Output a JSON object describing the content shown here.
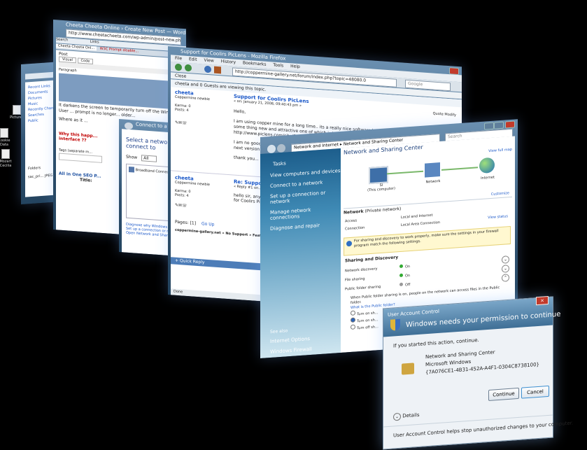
{
  "desktop": {
    "icons": [
      "Pictures",
      "Cookie Data",
      "Mozart Cecilia"
    ]
  },
  "explorer": {
    "tree": [
      "Recent Links",
      "Documents",
      "Pictures",
      "Music",
      "Recently Changed",
      "Searches",
      "Public"
    ],
    "folders_label": "Folders",
    "file": "sac_pri... JPEG Ima..."
  },
  "wp_window": {
    "title": "Cheeta Cheeta Online › Create New Post — WordPress — Windows Internet Explorer",
    "address": "http://www.cheetacheeta.com/wp-admin/post-new.php",
    "search_label": "Search",
    "links_label": "Links",
    "tabs": [
      "Cheeta Cheeta Onl...",
      "W3C Prompt disable..."
    ],
    "post_label": "Post",
    "editor_tabs": [
      "Visual",
      "Code"
    ],
    "paragraph": "Paragraph",
    "body_text": "It darkens the screen to temporarily turn off the Windows. User ... prompt is no longer... older...",
    "q1": "Where as it ...",
    "heading": "Why this happ...",
    "heading2": "interface ??",
    "tags_label": "Tags (separate m...",
    "seo": "All in One SEO P...",
    "seo_title": "Title:"
  },
  "connect_window": {
    "title": "Connect to a network",
    "heading": "Select a network to connect to",
    "show_label": "Show",
    "show_value": "All",
    "item": "Broadband Connection",
    "links": [
      "Diagnose why Windows cannot...",
      "Set up a connection or network",
      "Open Network and Sharing Center"
    ]
  },
  "firefox": {
    "title": "Support for Coolirs PicLens - Mozilla Firefox",
    "menu": [
      "File",
      "Edit",
      "View",
      "History",
      "Bookmarks",
      "Tools",
      "Help"
    ],
    "url": "http://coppermine-gallery.net/forum/index.php?topic=48080.0",
    "search_placeholder": "Google",
    "close_label": "Close",
    "viewing": "cheeta and 0 Guests are viewing this topic.",
    "posts": [
      {
        "author": "cheeta",
        "rank": "Coppermine newbie",
        "karma": "Karma: 0",
        "posts": "Posts: 4",
        "subject": "Support for Coolirs PicLens",
        "date": "« on: January 21, 2008, 09:40:43 pm »",
        "quote": "Quote",
        "modify": "Modify",
        "lines": [
          "Hello,",
          "I am using copper mine for a long time.. its a really nice software but with Web 2.0 is in real need for some thing new and attractive one of which is indeed Coolirs PicLens >> http://www.piclens.com/site/firefox/win/",
          "I am no good at coding :( so I am looking for a mod and if possible then native support for PicLens on the next version :)",
          "thank you..."
        ]
      },
      {
        "author": "cheeta",
        "rank": "Coppermine newbie",
        "karma": "Karma: 0",
        "posts": "Posts: 4",
        "subject": "Re: Support...",
        "date": "« Reply #1 on...",
        "lines": [
          "hello sir, any b...",
          "for Coolirs PicLe..."
        ]
      }
    ],
    "pages": "Pages: [1]",
    "go_up": "Go Up",
    "breadcrumb": "coppermine-gallery.net » No Support » Feature...",
    "quick_reply": "+ Quick Reply",
    "status": "Done"
  },
  "sharing_center": {
    "breadcrumb": [
      "Network and Internet",
      "Network and Sharing Center"
    ],
    "search_placeholder": "Search",
    "title": "Network and Sharing Center",
    "tasks_heading": "Tasks",
    "tasks": [
      "View computers and devices",
      "Connect to a network",
      "Set up a connection or network",
      "Manage network connections",
      "Diagnose and repair"
    ],
    "see_also": "See also",
    "see_also_links": [
      "Internet Options",
      "Windows Firewall"
    ],
    "view_full_map": "View full map",
    "map_nodes": [
      "SI\n(This computer)",
      "Network",
      "Internet"
    ],
    "customize": "Customize",
    "network_name": "Network",
    "network_type": "(Private network)",
    "rows": [
      {
        "k": "Access",
        "v": "Local and Internet"
      },
      {
        "k": "Connection",
        "v": "Local Area Connection"
      }
    ],
    "view_status": "View status",
    "warning": "For sharing and discovery to work properly, make sure the settings in your firewall program match the following settings.",
    "sharing_heading": "Sharing and Discovery",
    "settings": [
      {
        "k": "Network discovery",
        "v": "On"
      },
      {
        "k": "File sharing",
        "v": "On"
      },
      {
        "k": "Public folder sharing",
        "v": "Off"
      }
    ],
    "public_text": "When Public folder sharing is on, people on the network can access files in the Public folder.",
    "public_link": "What is the Public folder?",
    "radios": [
      "Turn on sh...",
      "Turn on sh...",
      "Turn off sh..."
    ]
  },
  "uac": {
    "header_title": "User Account Control",
    "headline": "Windows needs your permission to continue",
    "intro": "If you started this action, continue.",
    "program": "Network and Sharing Center",
    "publisher": "Microsoft Windows",
    "guid": "{7A076CE1-4B31-452A-A4F1-0304C8738100}",
    "continue_label": "Continue",
    "cancel_label": "Cancel",
    "details_label": "Details",
    "footer": "User Account Control helps stop unauthorized changes to your computer."
  }
}
